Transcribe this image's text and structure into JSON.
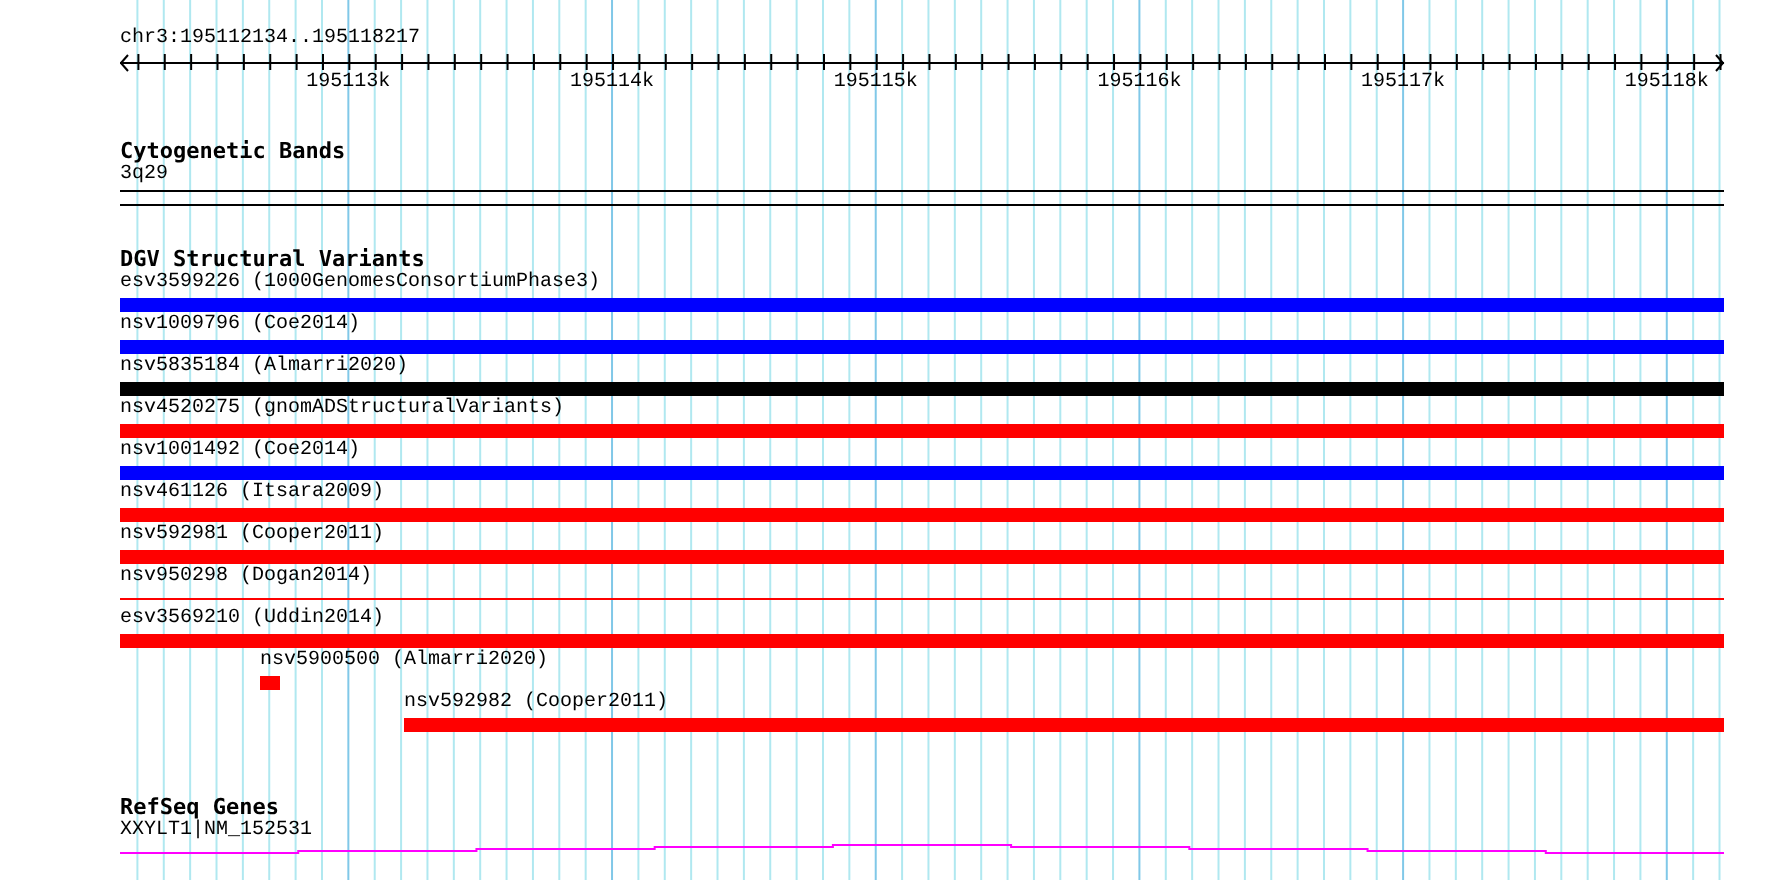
{
  "ruler": {
    "label": "chr3:195112134..195118217",
    "ticks": [
      {
        "label": "195113k"
      },
      {
        "label": "195114k"
      },
      {
        "label": "195115k"
      },
      {
        "label": "195116k"
      },
      {
        "label": "195117k"
      },
      {
        "label": "195118k"
      }
    ]
  },
  "cytogenetic_bands": {
    "title": "Cytogenetic Bands",
    "band": "3q29"
  },
  "dgv_variants": {
    "title": "DGV Structural Variants",
    "items": [
      {
        "label": "esv3599226 (1000GenomesConsortiumPhase3)",
        "kind": "bar",
        "color": "#0000ff"
      },
      {
        "label": "nsv1009796 (Coe2014)",
        "kind": "bar",
        "color": "#0000ff"
      },
      {
        "label": "nsv5835184 (Almarri2020)",
        "kind": "bar",
        "color": "#000000"
      },
      {
        "label": "nsv4520275 (gnomADStructuralVariants)",
        "kind": "bar",
        "color": "#ff0000"
      },
      {
        "label": "nsv1001492 (Coe2014)",
        "kind": "bar",
        "color": "#0000ff"
      },
      {
        "label": "nsv461126 (Itsara2009)",
        "kind": "bar",
        "color": "#ff0000"
      },
      {
        "label": "nsv592981 (Cooper2011)",
        "kind": "bar",
        "color": "#ff0000"
      },
      {
        "label": "nsv950298 (Dogan2014)",
        "kind": "line",
        "color": "#ff0000"
      },
      {
        "label": "esv3569210 (Uddin2014)",
        "kind": "bar",
        "color": "#ff0000"
      },
      {
        "label": "nsv5900500 (Almarri2020)",
        "kind": "bar",
        "color": "#ff0000"
      },
      {
        "label": "nsv592982 (Cooper2011)",
        "kind": "bar",
        "color": "#ff0000"
      }
    ]
  },
  "refseq_genes": {
    "title": "RefSeq Genes",
    "genes": [
      {
        "label": "XXYLT1|NM_152531"
      }
    ]
  }
}
